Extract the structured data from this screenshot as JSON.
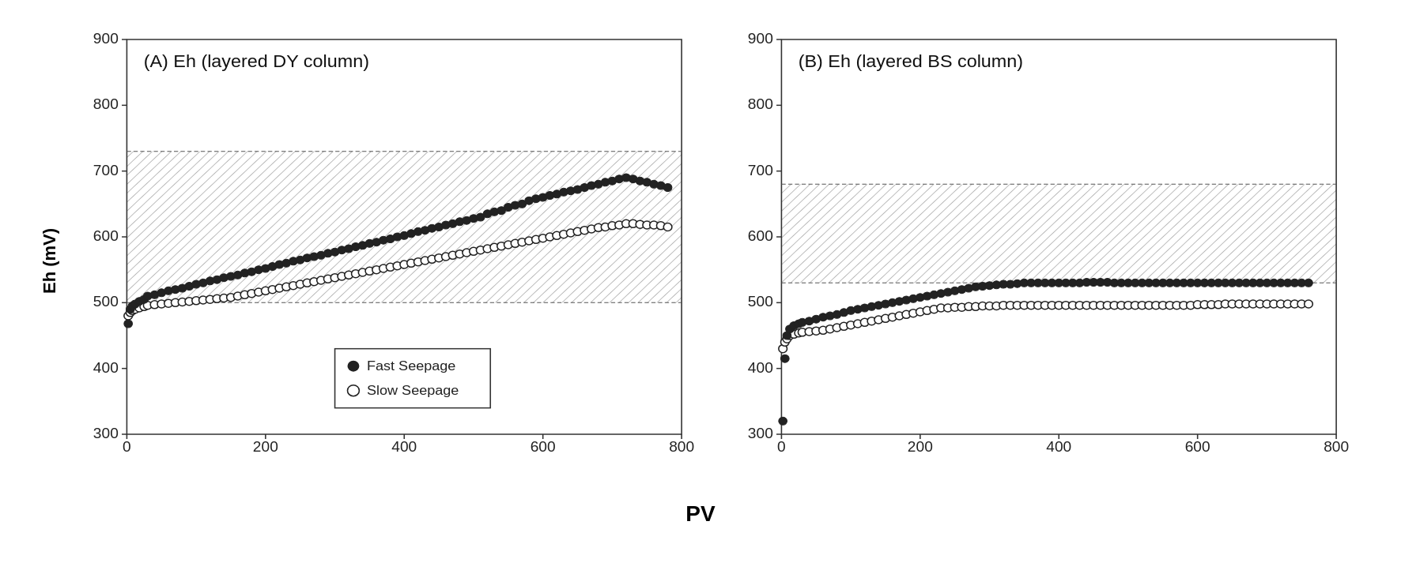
{
  "charts": {
    "yAxisLabel": "Eh (mV)",
    "xAxisLabel": "PV",
    "panelA": {
      "title": "(A) Eh (layered DY column)",
      "xMin": 0,
      "xMax": 800,
      "yMin": 300,
      "yMax": 900,
      "hatchTop": 730,
      "hatchBottom": 500,
      "xTicks": [
        0,
        200,
        400,
        600,
        800
      ],
      "yTicks": [
        300,
        400,
        500,
        600,
        700,
        800,
        900
      ],
      "fastSeepage": [
        [
          2,
          468
        ],
        [
          5,
          490
        ],
        [
          8,
          495
        ],
        [
          12,
          498
        ],
        [
          18,
          502
        ],
        [
          25,
          505
        ],
        [
          30,
          510
        ],
        [
          40,
          512
        ],
        [
          50,
          515
        ],
        [
          60,
          518
        ],
        [
          70,
          520
        ],
        [
          80,
          522
        ],
        [
          90,
          525
        ],
        [
          100,
          528
        ],
        [
          110,
          530
        ],
        [
          120,
          533
        ],
        [
          130,
          535
        ],
        [
          140,
          538
        ],
        [
          150,
          540
        ],
        [
          160,
          542
        ],
        [
          170,
          545
        ],
        [
          180,
          547
        ],
        [
          190,
          550
        ],
        [
          200,
          552
        ],
        [
          210,
          555
        ],
        [
          220,
          558
        ],
        [
          230,
          560
        ],
        [
          240,
          563
        ],
        [
          250,
          565
        ],
        [
          260,
          568
        ],
        [
          270,
          570
        ],
        [
          280,
          572
        ],
        [
          290,
          575
        ],
        [
          300,
          577
        ],
        [
          310,
          580
        ],
        [
          320,
          582
        ],
        [
          330,
          585
        ],
        [
          340,
          587
        ],
        [
          350,
          590
        ],
        [
          360,
          592
        ],
        [
          370,
          595
        ],
        [
          380,
          597
        ],
        [
          390,
          600
        ],
        [
          400,
          602
        ],
        [
          410,
          605
        ],
        [
          420,
          608
        ],
        [
          430,
          610
        ],
        [
          440,
          613
        ],
        [
          450,
          615
        ],
        [
          460,
          618
        ],
        [
          470,
          620
        ],
        [
          480,
          623
        ],
        [
          490,
          625
        ],
        [
          500,
          628
        ],
        [
          510,
          630
        ],
        [
          520,
          635
        ],
        [
          530,
          638
        ],
        [
          540,
          640
        ],
        [
          550,
          645
        ],
        [
          560,
          648
        ],
        [
          570,
          650
        ],
        [
          580,
          655
        ],
        [
          590,
          658
        ],
        [
          600,
          660
        ],
        [
          610,
          663
        ],
        [
          620,
          665
        ],
        [
          630,
          668
        ],
        [
          640,
          670
        ],
        [
          650,
          672
        ],
        [
          660,
          675
        ],
        [
          670,
          678
        ],
        [
          680,
          680
        ],
        [
          690,
          683
        ],
        [
          700,
          685
        ],
        [
          710,
          688
        ],
        [
          720,
          690
        ],
        [
          730,
          688
        ],
        [
          740,
          685
        ],
        [
          750,
          683
        ],
        [
          760,
          680
        ],
        [
          770,
          678
        ],
        [
          780,
          675
        ]
      ],
      "slowSeepage": [
        [
          2,
          480
        ],
        [
          5,
          485
        ],
        [
          8,
          488
        ],
        [
          12,
          490
        ],
        [
          18,
          492
        ],
        [
          25,
          494
        ],
        [
          30,
          496
        ],
        [
          40,
          497
        ],
        [
          50,
          498
        ],
        [
          60,
          499
        ],
        [
          70,
          500
        ],
        [
          80,
          501
        ],
        [
          90,
          502
        ],
        [
          100,
          503
        ],
        [
          110,
          504
        ],
        [
          120,
          505
        ],
        [
          130,
          506
        ],
        [
          140,
          507
        ],
        [
          150,
          508
        ],
        [
          160,
          510
        ],
        [
          170,
          512
        ],
        [
          180,
          514
        ],
        [
          190,
          516
        ],
        [
          200,
          518
        ],
        [
          210,
          520
        ],
        [
          220,
          522
        ],
        [
          230,
          524
        ],
        [
          240,
          526
        ],
        [
          250,
          528
        ],
        [
          260,
          530
        ],
        [
          270,
          532
        ],
        [
          280,
          534
        ],
        [
          290,
          536
        ],
        [
          300,
          538
        ],
        [
          310,
          540
        ],
        [
          320,
          542
        ],
        [
          330,
          544
        ],
        [
          340,
          546
        ],
        [
          350,
          548
        ],
        [
          360,
          550
        ],
        [
          370,
          552
        ],
        [
          380,
          554
        ],
        [
          390,
          556
        ],
        [
          400,
          558
        ],
        [
          410,
          560
        ],
        [
          420,
          562
        ],
        [
          430,
          564
        ],
        [
          440,
          566
        ],
        [
          450,
          568
        ],
        [
          460,
          570
        ],
        [
          470,
          572
        ],
        [
          480,
          574
        ],
        [
          490,
          576
        ],
        [
          500,
          578
        ],
        [
          510,
          580
        ],
        [
          520,
          582
        ],
        [
          530,
          584
        ],
        [
          540,
          586
        ],
        [
          550,
          588
        ],
        [
          560,
          590
        ],
        [
          570,
          592
        ],
        [
          580,
          594
        ],
        [
          590,
          596
        ],
        [
          600,
          598
        ],
        [
          610,
          600
        ],
        [
          620,
          602
        ],
        [
          630,
          604
        ],
        [
          640,
          606
        ],
        [
          650,
          608
        ],
        [
          660,
          610
        ],
        [
          670,
          612
        ],
        [
          680,
          614
        ],
        [
          690,
          615
        ],
        [
          700,
          617
        ],
        [
          710,
          618
        ],
        [
          720,
          620
        ],
        [
          730,
          620
        ],
        [
          740,
          619
        ],
        [
          750,
          618
        ],
        [
          760,
          618
        ],
        [
          770,
          617
        ],
        [
          780,
          615
        ]
      ]
    },
    "panelB": {
      "title": "(B) Eh (layered BS column)",
      "xMin": 0,
      "xMax": 800,
      "yMin": 300,
      "yMax": 900,
      "hatchTop": 680,
      "hatchBottom": 530,
      "xTicks": [
        0,
        200,
        400,
        600,
        800
      ],
      "yTicks": [
        300,
        400,
        500,
        600,
        700,
        800,
        900
      ],
      "fastSeepage": [
        [
          2,
          320
        ],
        [
          5,
          415
        ],
        [
          8,
          450
        ],
        [
          12,
          460
        ],
        [
          18,
          465
        ],
        [
          25,
          468
        ],
        [
          30,
          470
        ],
        [
          40,
          472
        ],
        [
          50,
          475
        ],
        [
          60,
          478
        ],
        [
          70,
          480
        ],
        [
          80,
          482
        ],
        [
          90,
          485
        ],
        [
          100,
          488
        ],
        [
          110,
          490
        ],
        [
          120,
          492
        ],
        [
          130,
          494
        ],
        [
          140,
          496
        ],
        [
          150,
          498
        ],
        [
          160,
          500
        ],
        [
          170,
          502
        ],
        [
          180,
          504
        ],
        [
          190,
          506
        ],
        [
          200,
          508
        ],
        [
          210,
          510
        ],
        [
          220,
          512
        ],
        [
          230,
          514
        ],
        [
          240,
          516
        ],
        [
          250,
          518
        ],
        [
          260,
          520
        ],
        [
          270,
          522
        ],
        [
          280,
          524
        ],
        [
          290,
          525
        ],
        [
          300,
          526
        ],
        [
          310,
          527
        ],
        [
          320,
          528
        ],
        [
          330,
          528
        ],
        [
          340,
          529
        ],
        [
          350,
          530
        ],
        [
          360,
          530
        ],
        [
          370,
          530
        ],
        [
          380,
          530
        ],
        [
          390,
          530
        ],
        [
          400,
          530
        ],
        [
          410,
          530
        ],
        [
          420,
          530
        ],
        [
          430,
          530
        ],
        [
          440,
          531
        ],
        [
          450,
          531
        ],
        [
          460,
          531
        ],
        [
          470,
          531
        ],
        [
          480,
          530
        ],
        [
          490,
          530
        ],
        [
          500,
          530
        ],
        [
          510,
          530
        ],
        [
          520,
          530
        ],
        [
          530,
          530
        ],
        [
          540,
          530
        ],
        [
          550,
          530
        ],
        [
          560,
          530
        ],
        [
          570,
          530
        ],
        [
          580,
          530
        ],
        [
          590,
          530
        ],
        [
          600,
          530
        ],
        [
          610,
          530
        ],
        [
          620,
          530
        ],
        [
          630,
          530
        ],
        [
          640,
          530
        ],
        [
          650,
          530
        ],
        [
          660,
          530
        ],
        [
          670,
          530
        ],
        [
          680,
          530
        ],
        [
          690,
          530
        ],
        [
          700,
          530
        ],
        [
          710,
          530
        ],
        [
          720,
          530
        ],
        [
          730,
          530
        ],
        [
          740,
          530
        ],
        [
          750,
          530
        ],
        [
          760,
          530
        ]
      ],
      "slowSeepage": [
        [
          2,
          430
        ],
        [
          5,
          440
        ],
        [
          8,
          445
        ],
        [
          12,
          450
        ],
        [
          18,
          452
        ],
        [
          25,
          454
        ],
        [
          30,
          455
        ],
        [
          40,
          456
        ],
        [
          50,
          457
        ],
        [
          60,
          458
        ],
        [
          70,
          460
        ],
        [
          80,
          462
        ],
        [
          90,
          464
        ],
        [
          100,
          466
        ],
        [
          110,
          468
        ],
        [
          120,
          470
        ],
        [
          130,
          472
        ],
        [
          140,
          474
        ],
        [
          150,
          476
        ],
        [
          160,
          478
        ],
        [
          170,
          480
        ],
        [
          180,
          482
        ],
        [
          190,
          484
        ],
        [
          200,
          486
        ],
        [
          210,
          488
        ],
        [
          220,
          490
        ],
        [
          230,
          492
        ],
        [
          240,
          492
        ],
        [
          250,
          493
        ],
        [
          260,
          493
        ],
        [
          270,
          494
        ],
        [
          280,
          494
        ],
        [
          290,
          495
        ],
        [
          300,
          495
        ],
        [
          310,
          495
        ],
        [
          320,
          496
        ],
        [
          330,
          496
        ],
        [
          340,
          496
        ],
        [
          350,
          496
        ],
        [
          360,
          496
        ],
        [
          370,
          496
        ],
        [
          380,
          496
        ],
        [
          390,
          496
        ],
        [
          400,
          496
        ],
        [
          410,
          496
        ],
        [
          420,
          496
        ],
        [
          430,
          496
        ],
        [
          440,
          496
        ],
        [
          450,
          496
        ],
        [
          460,
          496
        ],
        [
          470,
          496
        ],
        [
          480,
          496
        ],
        [
          490,
          496
        ],
        [
          500,
          496
        ],
        [
          510,
          496
        ],
        [
          520,
          496
        ],
        [
          530,
          496
        ],
        [
          540,
          496
        ],
        [
          550,
          496
        ],
        [
          560,
          496
        ],
        [
          570,
          496
        ],
        [
          580,
          496
        ],
        [
          590,
          496
        ],
        [
          600,
          497
        ],
        [
          610,
          497
        ],
        [
          620,
          497
        ],
        [
          630,
          497
        ],
        [
          640,
          498
        ],
        [
          650,
          498
        ],
        [
          660,
          498
        ],
        [
          670,
          498
        ],
        [
          680,
          498
        ],
        [
          690,
          498
        ],
        [
          700,
          498
        ],
        [
          710,
          498
        ],
        [
          720,
          498
        ],
        [
          730,
          498
        ],
        [
          740,
          498
        ],
        [
          750,
          498
        ],
        [
          760,
          498
        ]
      ]
    },
    "legend": {
      "fastSeepageLabel": "Fast Seepage",
      "slowSeepageLabel": "Slow Seepage"
    }
  }
}
